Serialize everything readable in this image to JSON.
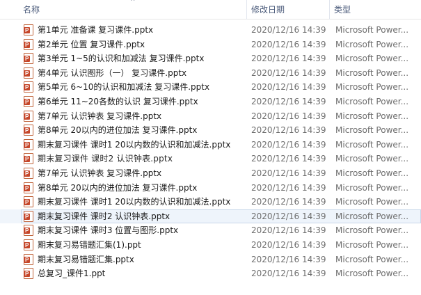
{
  "header": {
    "name_label": "名称",
    "date_label": "修改日期",
    "type_label": "类型",
    "sort_indicator": "^"
  },
  "files": [
    {
      "name": "第1单元 准备课 复习课件.pptx",
      "date": "2020/12/16 14:39",
      "type": "Microsoft Power..."
    },
    {
      "name": "第2单元 位置 复习课件.pptx",
      "date": "2020/12/16 14:39",
      "type": "Microsoft Power..."
    },
    {
      "name": "第3单元 1~5的认识和加减法 复习课件.pptx",
      "date": "2020/12/16 14:39",
      "type": "Microsoft Power..."
    },
    {
      "name": "第4单元 认识图形（一） 复习课件.pptx",
      "date": "2020/12/16 14:39",
      "type": "Microsoft Power..."
    },
    {
      "name": "第5单元 6~10的认识和加减法 复习课件.pptx",
      "date": "2020/12/16 14:39",
      "type": "Microsoft Power..."
    },
    {
      "name": "第6单元 11~20各数的认识 复习课件.pptx",
      "date": "2020/12/16 14:39",
      "type": "Microsoft Power..."
    },
    {
      "name": "第7单元 认识钟表 复习课件.pptx",
      "date": "2020/12/16 14:39",
      "type": "Microsoft Power..."
    },
    {
      "name": "第8单元 20以内的进位加法 复习课件.pptx",
      "date": "2020/12/16 14:39",
      "type": "Microsoft Power..."
    },
    {
      "name": "期末复习课件 课时1 20以内数的认识和加减法.pptx",
      "date": "2020/12/16 14:39",
      "type": "Microsoft Power..."
    },
    {
      "name": "期末复习课件 课时2 认识钟表.pptx",
      "date": "2020/12/16 14:39",
      "type": "Microsoft Power..."
    },
    {
      "name": "第7单元 认识钟表 复习课件.pptx",
      "date": "2020/12/16 14:39",
      "type": "Microsoft Power..."
    },
    {
      "name": "第8单元 20以内的进位加法 复习课件.pptx",
      "date": "2020/12/16 14:39",
      "type": "Microsoft Power..."
    },
    {
      "name": "期末复习课件 课时1 20以内数的认识和加减法.pptx",
      "date": "2020/12/16 14:39",
      "type": "Microsoft Power..."
    },
    {
      "name": "期末复习课件 课时2 认识钟表.pptx",
      "date": "2020/12/16 14:39",
      "type": "Microsoft Power..."
    },
    {
      "name": "期末复习课件 课时3 位置与图形.pptx",
      "date": "2020/12/16 14:39",
      "type": "Microsoft Power..."
    },
    {
      "name": "期末复习易错题汇集(1).ppt",
      "date": "2020/12/16 14:39",
      "type": "Microsoft Power..."
    },
    {
      "name": "期末复习易错题汇集.pptx",
      "date": "2020/12/16 14:39",
      "type": "Microsoft Power..."
    },
    {
      "name": "总复习_课件1.ppt",
      "date": "2020/12/16 14:39",
      "type": "Microsoft Power..."
    }
  ],
  "selected_index": 13,
  "icon": "powerpoint-file-icon",
  "colors": {
    "header_text": "#4a5a7a",
    "meta_text": "#6d6d6d",
    "selection_bg": "#eef4fb",
    "selection_border": "#c8d7ea",
    "ppt_icon": "#c5472a"
  }
}
